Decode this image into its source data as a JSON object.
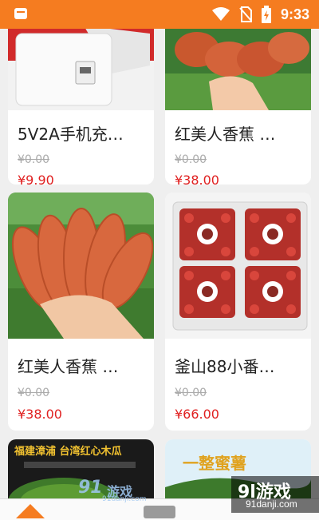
{
  "statusbar": {
    "time": "9:33"
  },
  "products": [
    {
      "title": "5V2A手机充…",
      "old_price": "¥0.00",
      "price": "¥9.90",
      "image": "phone-charger"
    },
    {
      "title": "红美人香蕉 …",
      "old_price": "¥0.00",
      "price": "¥38.00",
      "image": "red-banana"
    },
    {
      "title": "红美人香蕉 …",
      "old_price": "¥0.00",
      "price": "¥38.00",
      "image": "red-banana"
    },
    {
      "title": "釜山88小番…",
      "old_price": "¥0.00",
      "price": "¥66.00",
      "image": "cherry-tomatoes"
    },
    {
      "title": "",
      "image": "taiwan-red-pear-guava",
      "banner_text": "福建漳浦 台湾红心木瓜"
    },
    {
      "title": "",
      "image": "honeydew-melon",
      "banner_text": "一整蜜薯"
    }
  ],
  "watermark": {
    "main": "9l游戏",
    "sub": "91danji.com"
  },
  "watermark2": {
    "a": "91",
    "b": "游戏",
    "c": "91danji.com"
  },
  "colors": {
    "accent": "#f57c20",
    "price": "#e02020"
  }
}
